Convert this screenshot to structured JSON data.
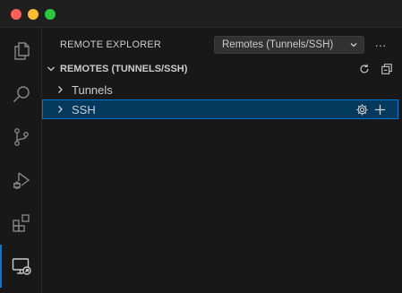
{
  "window": {
    "traffic_lights": [
      "close",
      "minimize",
      "maximize"
    ]
  },
  "activity_bar": {
    "items": [
      {
        "icon": "files-icon",
        "active": false
      },
      {
        "icon": "search-icon",
        "active": false
      },
      {
        "icon": "source-control-icon",
        "active": false
      },
      {
        "icon": "run-debug-icon",
        "active": false
      },
      {
        "icon": "extensions-icon",
        "active": false
      },
      {
        "icon": "remote-explorer-icon",
        "active": true
      }
    ]
  },
  "sidebar": {
    "title": "REMOTE EXPLORER",
    "dropdown_value": "Remotes (Tunnels/SSH)",
    "more_label": "···",
    "section": {
      "title": "REMOTES (TUNNELS/SSH)",
      "actions": [
        "refresh-icon",
        "collapse-all-icon"
      ]
    },
    "items": [
      {
        "label": "Tunnels",
        "selected": false
      },
      {
        "label": "SSH",
        "selected": true,
        "actions": [
          "gear-icon",
          "plus-icon"
        ]
      }
    ]
  },
  "colors": {
    "accent": "#0078d4",
    "selection_bg": "#04395e",
    "background": "#181818",
    "foreground": "#cccccc"
  }
}
